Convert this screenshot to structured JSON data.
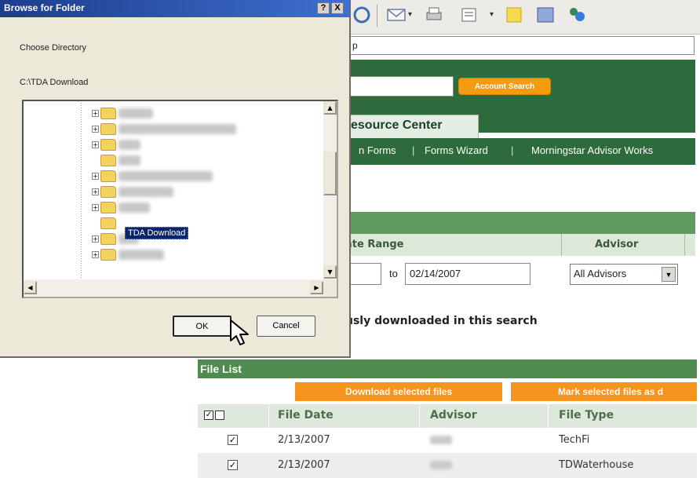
{
  "browser": {
    "address_text": "p",
    "account_search_label": "Account Search",
    "tab_label": "esource Center",
    "nav_items": [
      "n Forms",
      "Forms Wizard",
      "Morningstar Advisor Works"
    ],
    "columns": {
      "date_range": "ate Range",
      "advisor": "Advisor"
    },
    "to_label": "to",
    "date_to_value": "02/14/2007",
    "advisor_select_value": "All Advisors",
    "previously_text": "usly downloaded in this search"
  },
  "file_list": {
    "title": "File List",
    "download_button": "Download selected files",
    "mark_button": "Mark selected files as d",
    "headers": {
      "file_date": "File Date",
      "advisor": "Advisor",
      "file_type": "File Type"
    },
    "rows": [
      {
        "checked": true,
        "file_date": "2/13/2007",
        "file_type": "TechFi"
      },
      {
        "checked": true,
        "file_date": "2/13/2007",
        "file_type": "TDWaterhouse"
      }
    ]
  },
  "dialog": {
    "title": "Browse for Folder",
    "help_glyph": "?",
    "close_glyph": "X",
    "choose_label": "Choose Directory",
    "path": "C:\\TDA Download",
    "selected_folder": "TDA Download",
    "ok_label": "OK",
    "cancel_label": "Cancel"
  },
  "colors": {
    "green_dark": "#2e6b3a",
    "orange": "#f7941d",
    "selection": "#0a246a"
  }
}
